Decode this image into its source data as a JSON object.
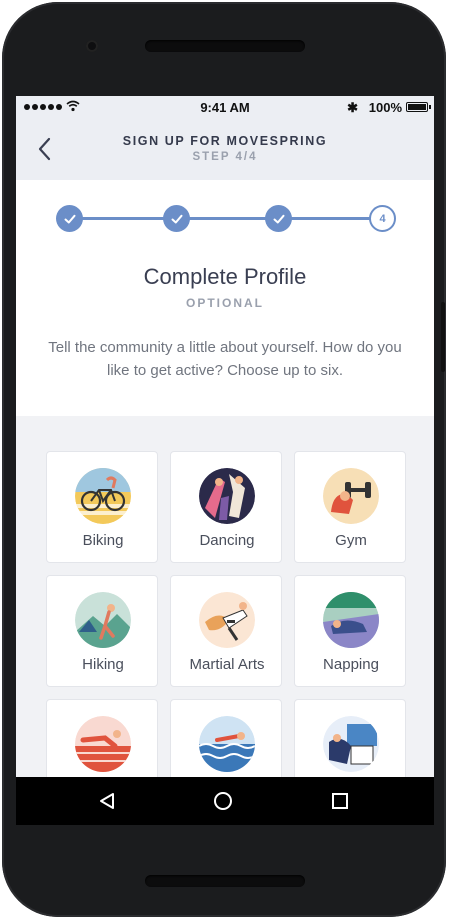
{
  "status_bar": {
    "time": "9:41 AM",
    "battery": "100%"
  },
  "header": {
    "title": "SIGN UP FOR MOVESPRING",
    "step": "STEP 4/4"
  },
  "stepper": {
    "current_step_number": "4"
  },
  "profile": {
    "title": "Complete Profile",
    "subtitle": "OPTIONAL",
    "description": "Tell the community a little about yourself. How do you like to get active? Choose up to six."
  },
  "activities": [
    {
      "label": "Biking",
      "icon": "biking-icon"
    },
    {
      "label": "Dancing",
      "icon": "dancing-icon"
    },
    {
      "label": "Gym",
      "icon": "gym-icon"
    },
    {
      "label": "Hiking",
      "icon": "hiking-icon"
    },
    {
      "label": "Martial Arts",
      "icon": "martial-arts-icon"
    },
    {
      "label": "Napping",
      "icon": "napping-icon"
    },
    {
      "label": "",
      "icon": "running-icon"
    },
    {
      "label": "",
      "icon": "swimming-icon"
    },
    {
      "label": "",
      "icon": "tap-icon"
    }
  ],
  "colors": {
    "accent": "#6b8ec8",
    "header_bg": "#eceef3",
    "grid_bg": "#f1f2f5"
  }
}
